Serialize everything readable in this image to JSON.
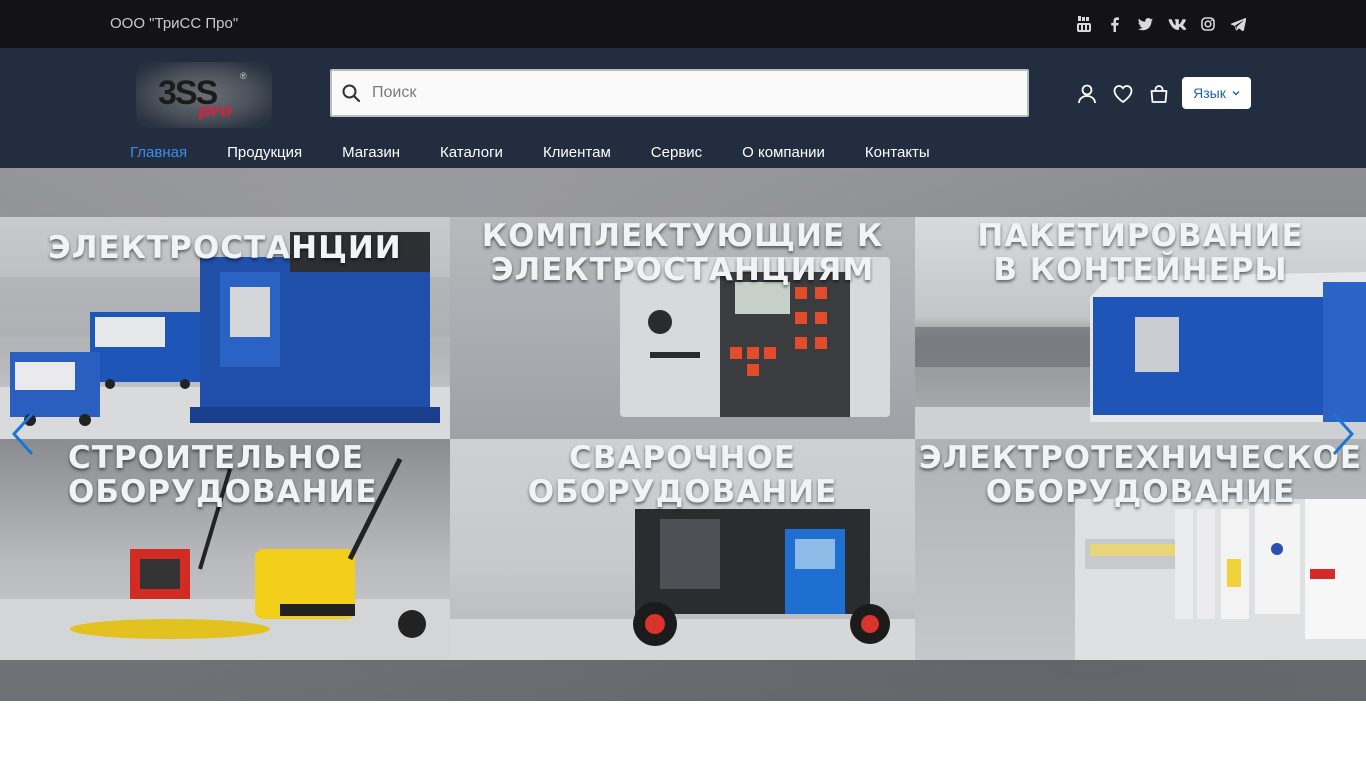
{
  "topbar": {
    "company": "ООО \"ТриСС Про\"",
    "socials": [
      {
        "icon": "youtube-icon"
      },
      {
        "icon": "facebook-icon"
      },
      {
        "icon": "twitter-icon"
      },
      {
        "icon": "vk-icon"
      },
      {
        "icon": "instagram-icon"
      },
      {
        "icon": "telegram-icon"
      }
    ]
  },
  "header": {
    "logo": {
      "text": "3SS",
      "sub": "pro",
      "mark": "®"
    },
    "search": {
      "placeholder": "Поиск",
      "value": ""
    },
    "icons": [
      "user-icon",
      "heart-icon",
      "bag-icon"
    ],
    "language": {
      "label": "Язык"
    }
  },
  "nav": {
    "items": [
      {
        "label": "Главная",
        "active": true
      },
      {
        "label": "Продукция"
      },
      {
        "label": "Магазин"
      },
      {
        "label": "Каталоги"
      },
      {
        "label": "Клиентам"
      },
      {
        "label": "Сервис"
      },
      {
        "label": "О компании"
      },
      {
        "label": "Контакты"
      }
    ]
  },
  "hero": {
    "tiles": [
      {
        "title": "ЭЛЕКТРОСТАНЦИИ"
      },
      {
        "title": "КОМПЛЕКТУЮЩИЕ К ЭЛЕКТРОСТАНЦИЯМ"
      },
      {
        "title": "ПАКЕТИРОВАНИЕ В КОНТЕЙНЕРЫ"
      },
      {
        "title": "СТРОИТЕЛЬНОЕ ОБОРУДОВАНИЕ"
      },
      {
        "title": "СВАРОЧНОЕ ОБОРУДОВАНИЕ"
      },
      {
        "title": "ЭЛЕКТРОТЕХНИЧЕСКОЕ ОБОРУДОВАНИЕ"
      }
    ],
    "prev_icon": "chevron-left-icon",
    "next_icon": "chevron-right-icon",
    "accent": "#1e73d8"
  },
  "colors": {
    "topbar_bg": "#121217",
    "header_bg": "#222d3f",
    "nav_active": "#3b8ee6",
    "language_text": "#1f5fa8"
  }
}
